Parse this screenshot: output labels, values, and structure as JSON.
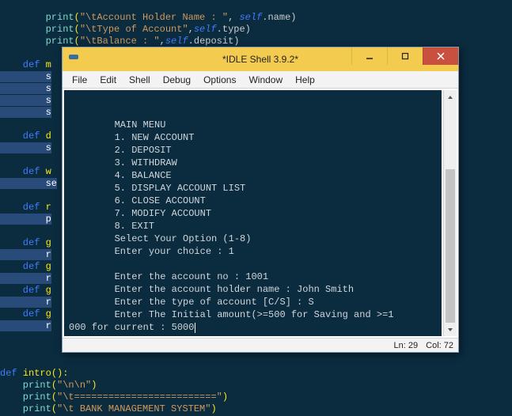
{
  "bg": {
    "line1_a": "        print",
    "line1_b": "(",
    "line1_c": "\"\\tAccount Holder Name : \"",
    "line1_d": ", ",
    "line1_e": "self",
    "line1_f": ".name)",
    "line2_a": "        print",
    "line2_b": "(",
    "line2_c": "\"\\tType of Account\"",
    "line2_d": ",",
    "line2_e": "self",
    "line2_f": ".type)",
    "line3_a": "        print",
    "line3_b": "(",
    "line3_c": "\"\\tBalance : \"",
    "line3_d": ",",
    "line3_e": "self",
    "line3_f": ".deposit)",
    "blank": "",
    "def": "    def ",
    "mname": "m",
    "s_pref": "        s",
    "dname": "d",
    "wname": "w",
    "rname": "r",
    "gname": "g",
    "p_pref": "        p",
    "r_pref": "        r",
    "se_pref": "        se",
    "intro_def": "def ",
    "intro_name": "intro",
    "intro_paren": "():",
    "pA_a": "    print",
    "pA_b": "(",
    "pA_c": "\"\\n\\n\"",
    "pA_d": ")",
    "pB_a": "    print",
    "pB_b": "(",
    "pB_c": "\"\\t=========================\"",
    "pB_d": ")",
    "pC_a": "    print",
    "pC_b": "(",
    "pC_c": "\"\\t BANK MANAGEMENT SYSTEM\"",
    "pC_d": ")"
  },
  "idle": {
    "title": "*IDLE Shell 3.9.2*",
    "menu": {
      "file": "File",
      "edit": "Edit",
      "shell": "Shell",
      "debug": "Debug",
      "options": "Options",
      "window": "Window",
      "help": "Help"
    },
    "shell_lines": {
      "l1": "",
      "l2": "",
      "l3": "        MAIN MENU",
      "l4": "        1. NEW ACCOUNT",
      "l5": "        2. DEPOSIT",
      "l6": "        3. WITHDRAW",
      "l7": "        4. BALANCE",
      "l8": "        5. DISPLAY ACCOUNT LIST",
      "l9": "        6. CLOSE ACCOUNT",
      "l10": "        7. MODIFY ACCOUNT",
      "l11": "        8. EXIT",
      "l12": "        Select Your Option (1-8)",
      "l13": "        Enter your choice : 1",
      "l14": "",
      "l15": "        Enter the account no : 1001",
      "l16": "        Enter the account holder name : John Smith",
      "l17": "        Enter the type of account [C/S] : S",
      "l18": "        Enter The Initial amount(>=500 for Saving and >=1",
      "l19": "000 for current : 5000"
    },
    "status": {
      "ln": "Ln: 29",
      "col": "Col: 72"
    }
  },
  "chart_data": {
    "type": "table",
    "title": "IDLE Shell session — Bank Management System",
    "menu_options": [
      {
        "num": 1,
        "label": "NEW ACCOUNT"
      },
      {
        "num": 2,
        "label": "DEPOSIT"
      },
      {
        "num": 3,
        "label": "WITHDRAW"
      },
      {
        "num": 4,
        "label": "BALANCE"
      },
      {
        "num": 5,
        "label": "DISPLAY ACCOUNT LIST"
      },
      {
        "num": 6,
        "label": "CLOSE ACCOUNT"
      },
      {
        "num": 7,
        "label": "MODIFY ACCOUNT"
      },
      {
        "num": 8,
        "label": "EXIT"
      }
    ],
    "inputs": {
      "choice": 1,
      "account_no": 1001,
      "account_holder_name": "John Smith",
      "account_type": "S",
      "initial_amount": 5000
    },
    "cursor": {
      "line": 29,
      "column": 72
    }
  }
}
